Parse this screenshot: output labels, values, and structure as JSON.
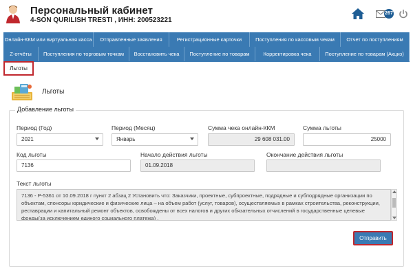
{
  "header": {
    "title": "Персональный кабинет",
    "subtitle": "4-SON QURILISH TRESTI , ИНН: 200523221",
    "mail_count": "267"
  },
  "tabs": [
    {
      "label": "Онлайн-ККМ или виртуальная касса"
    },
    {
      "label": "Отправленные заявления"
    },
    {
      "label": "Регистрационные карточки"
    },
    {
      "label": "Поступления по кассовым чекам"
    },
    {
      "label": "Отчет по поступлениям"
    },
    {
      "label": "Z-отчёты"
    },
    {
      "label": "Поступления по торговым точкам"
    },
    {
      "label": "Восстановить чека"
    },
    {
      "label": "Поступление по товарам"
    },
    {
      "label": "Корректировка чека"
    },
    {
      "label": "Поступление по товарам (Акциз)"
    },
    {
      "label": "Льготы"
    }
  ],
  "section": {
    "title": "Льготы",
    "panel_title": "Добавление льготы"
  },
  "form": {
    "year": {
      "label": "Период (Год)",
      "value": "2021"
    },
    "month": {
      "label": "Период (Месяц)",
      "value": "Январь"
    },
    "receipt_sum": {
      "label": "Сумма чека онлайн-ККМ",
      "value": "29 608 031.00"
    },
    "benefit_sum": {
      "label": "Сумма льготы",
      "value": "25000"
    },
    "benefit_code": {
      "label": "Код льготы",
      "value": "7136"
    },
    "start_date": {
      "label": "Начало действия льготы",
      "value": "01.09.2018"
    },
    "end_date": {
      "label": "Окончание действия льготы",
      "value": ""
    },
    "text": {
      "label": "Текст льготы",
      "value": "7136 - Р-5361 от 10.09.2018 г пункт 2 абзац 2 Установить что: Заказчики, проектные, субпроектные, подрядные и субподрядные организации по объектам, спонсоры юридические и физические лица – на объем работ (услуг, товаров), осуществляемых в рамках строительства, реконструкции, реставрации и капитальный ремонт объектов, освобождены от всех налогов и других обязательных отчислений в государственные целевые фонды(за исключением единого социального платежа) ."
    },
    "submit_label": "Отправить"
  }
}
